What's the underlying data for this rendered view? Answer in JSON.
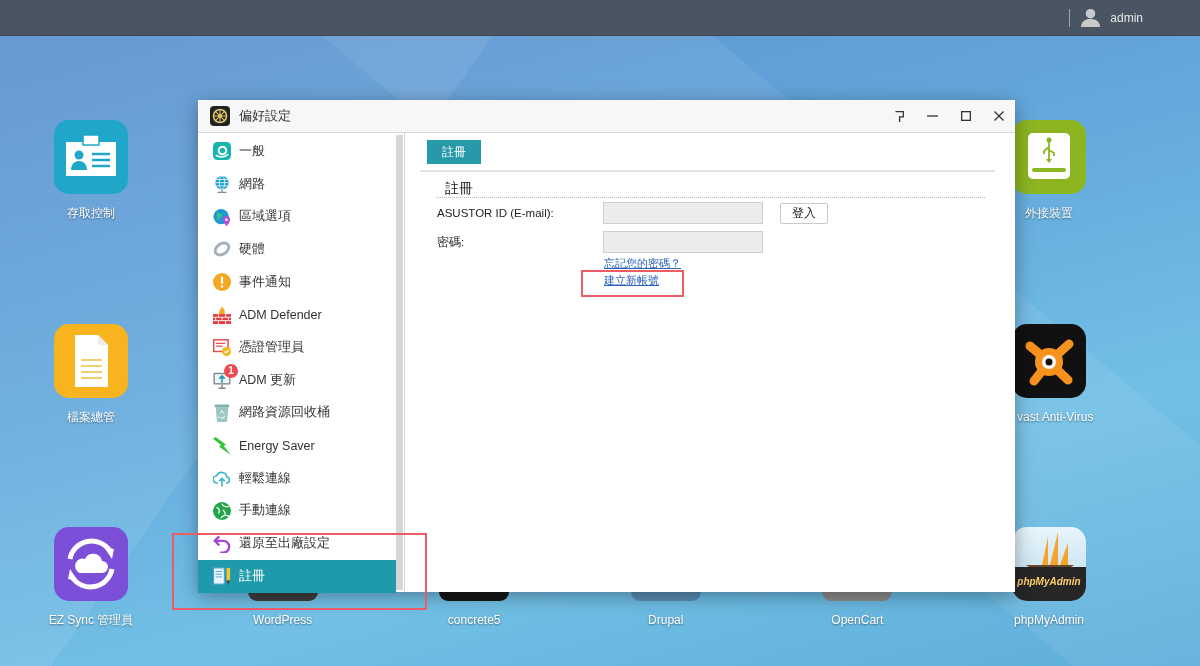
{
  "top_bar": {
    "user": "admin"
  },
  "desktop_icons": [
    {
      "label": "存取控制",
      "kind": "full"
    },
    {
      "label": "外接裝置",
      "kind": "full"
    },
    {
      "label": "檔案總管",
      "kind": "full"
    },
    {
      "label": "vast Anti-Virus",
      "kind": "cut"
    },
    {
      "label": "EZ Sync 管理員",
      "kind": "full"
    },
    {
      "label": "WordPress",
      "kind": "covered"
    },
    {
      "label": "concrete5",
      "kind": "covered"
    },
    {
      "label": "Drupal",
      "kind": "covered"
    },
    {
      "label": "OpenCart",
      "kind": "covered"
    },
    {
      "label": "phpMyAdmin",
      "kind": "full",
      "logo_text": "phpMyAdmin"
    }
  ],
  "window": {
    "title": "偏好設定"
  },
  "sidebar": {
    "items": [
      {
        "label": "一般",
        "selected": false
      },
      {
        "label": "網路",
        "selected": false
      },
      {
        "label": "區域選項",
        "selected": false
      },
      {
        "label": "硬體",
        "selected": false
      },
      {
        "label": "事件通知",
        "selected": false
      },
      {
        "label": "ADM Defender",
        "selected": false
      },
      {
        "label": "憑證管理員",
        "selected": false
      },
      {
        "label": "ADM 更新",
        "selected": false,
        "badge": "1"
      },
      {
        "label": "網路資源回收桶",
        "selected": false
      },
      {
        "label": "Energy Saver",
        "selected": false
      },
      {
        "label": "輕鬆連線",
        "selected": false
      },
      {
        "label": "手動連線",
        "selected": false
      },
      {
        "label": "還原至出廠設定",
        "selected": false
      },
      {
        "label": "註冊",
        "selected": true
      }
    ]
  },
  "content": {
    "tabs": [
      {
        "label": "註冊",
        "selected": true
      }
    ],
    "section_title": "註冊",
    "fields": [
      {
        "label": "ASUSTOR ID (E-mail):",
        "button": "登入"
      },
      {
        "label": "密碼:"
      }
    ],
    "links": [
      "忘記您的密碼？",
      "建立新帳號"
    ]
  }
}
